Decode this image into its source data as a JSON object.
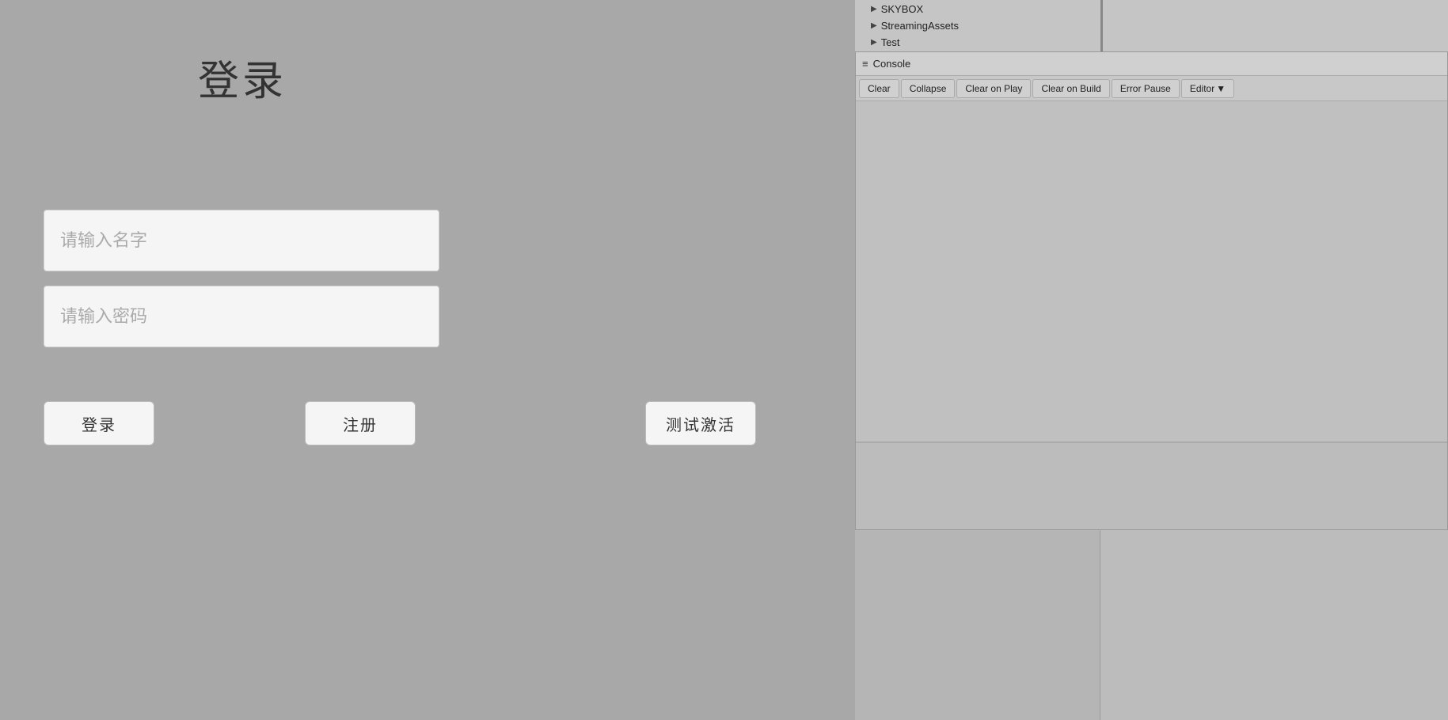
{
  "login": {
    "title": "登录",
    "username_placeholder": "请输入名字",
    "password_placeholder": "请输入密码",
    "login_button": "登录",
    "register_button": "注册",
    "test_button": "测试激活"
  },
  "editor": {
    "file_tree": {
      "items": [
        {
          "label": "SKYBOX"
        },
        {
          "label": "StreamingAssets"
        },
        {
          "label": "Test"
        }
      ]
    },
    "console": {
      "title": "Console",
      "icon": "≡",
      "toolbar": {
        "clear": "Clear",
        "collapse": "Collapse",
        "clear_on_play": "Clear on Play",
        "clear_on_build": "Clear on Build",
        "error_pause": "Error Pause",
        "editor": "Editor"
      }
    }
  }
}
